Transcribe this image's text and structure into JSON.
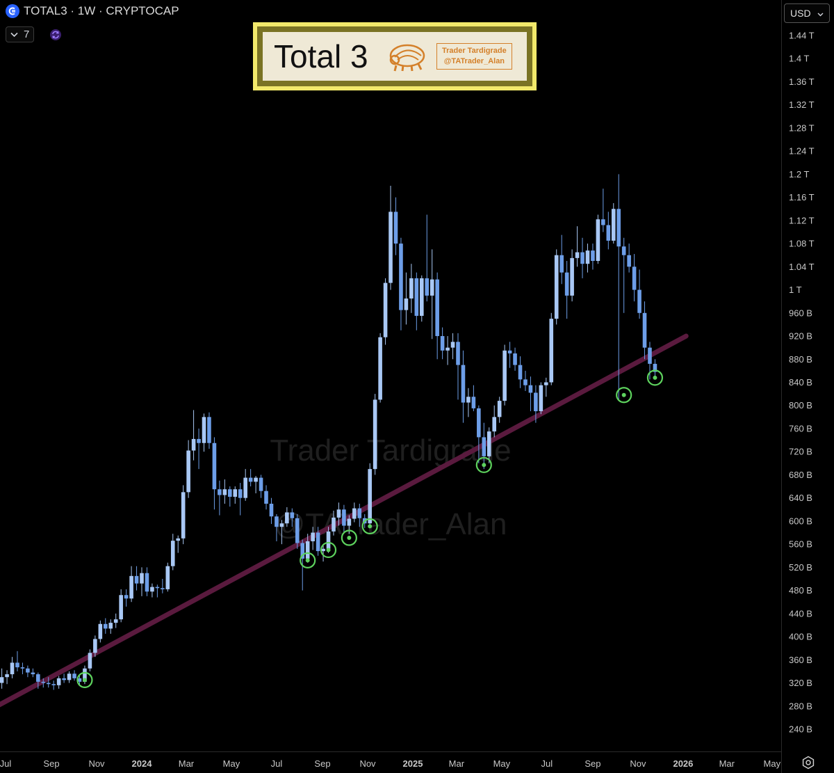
{
  "header": {
    "symbol": "TOTAL3 · 1W · CRYPTOCAP",
    "indicator_count": "7"
  },
  "banner": {
    "title": "Total 3",
    "logo_line1": "Trader Tardigrade",
    "logo_line2": "@TATrader_Alan"
  },
  "currency": "USD",
  "watermark": {
    "line1": "Trader Tardigrade",
    "line2": "@TATrader_Alan"
  },
  "colors": {
    "up": "#a9c8f5",
    "down": "#6d9ee8",
    "trendline": "#5a1a3e",
    "circle": "#5ed35e",
    "grid_text": "#c8c8c8"
  },
  "chart_data": {
    "type": "candlestick",
    "timeframe": "1W",
    "y_tick_labels": [
      "240 B",
      "280 B",
      "320 B",
      "360 B",
      "400 B",
      "440 B",
      "480 B",
      "520 B",
      "560 B",
      "600 B",
      "640 B",
      "680 B",
      "720 B",
      "760 B",
      "800 B",
      "840 B",
      "880 B",
      "920 B",
      "960 B",
      "1 T",
      "1.04 T",
      "1.08 T",
      "1.12 T",
      "1.16 T",
      "1.2 T",
      "1.24 T",
      "1.28 T",
      "1.32 T",
      "1.36 T",
      "1.4 T",
      "1.44 T"
    ],
    "y_tick_values": [
      240,
      280,
      320,
      360,
      400,
      440,
      480,
      520,
      560,
      600,
      640,
      680,
      720,
      760,
      800,
      840,
      880,
      920,
      960,
      1000,
      1040,
      1080,
      1120,
      1160,
      1200,
      1240,
      1280,
      1320,
      1360,
      1400,
      1440
    ],
    "y_unit": "B",
    "x_tick_labels": [
      "Jul",
      "Sep",
      "Nov",
      "2024",
      "Mar",
      "May",
      "Jul",
      "Sep",
      "Nov",
      "2025",
      "Mar",
      "May",
      "Jul",
      "Sep",
      "Nov",
      "2026",
      "Mar",
      "May"
    ],
    "x_tick_dates": [
      "2023-07-01",
      "2023-09-01",
      "2023-11-01",
      "2024-01-01",
      "2024-03-01",
      "2024-05-01",
      "2024-07-01",
      "2024-09-01",
      "2024-11-01",
      "2025-01-01",
      "2025-03-01",
      "2025-05-01",
      "2025-07-01",
      "2025-09-01",
      "2025-11-01",
      "2026-01-01",
      "2026-03-01",
      "2026-05-01"
    ],
    "candles": [
      {
        "d": "2023-06-26",
        "o": 320,
        "h": 345,
        "l": 310,
        "c": 330
      },
      {
        "d": "2023-07-03",
        "o": 330,
        "h": 342,
        "l": 318,
        "c": 335
      },
      {
        "d": "2023-07-10",
        "o": 335,
        "h": 365,
        "l": 328,
        "c": 355
      },
      {
        "d": "2023-07-17",
        "o": 355,
        "h": 375,
        "l": 340,
        "c": 347
      },
      {
        "d": "2023-07-24",
        "o": 347,
        "h": 355,
        "l": 335,
        "c": 345
      },
      {
        "d": "2023-07-31",
        "o": 345,
        "h": 350,
        "l": 330,
        "c": 338
      },
      {
        "d": "2023-08-07",
        "o": 338,
        "h": 345,
        "l": 330,
        "c": 335
      },
      {
        "d": "2023-08-14",
        "o": 335,
        "h": 338,
        "l": 310,
        "c": 322
      },
      {
        "d": "2023-08-21",
        "o": 322,
        "h": 328,
        "l": 312,
        "c": 320
      },
      {
        "d": "2023-08-28",
        "o": 320,
        "h": 330,
        "l": 312,
        "c": 318
      },
      {
        "d": "2023-09-04",
        "o": 318,
        "h": 324,
        "l": 308,
        "c": 316
      },
      {
        "d": "2023-09-11",
        "o": 316,
        "h": 332,
        "l": 310,
        "c": 328
      },
      {
        "d": "2023-09-18",
        "o": 328,
        "h": 336,
        "l": 320,
        "c": 325
      },
      {
        "d": "2023-09-25",
        "o": 325,
        "h": 340,
        "l": 320,
        "c": 336
      },
      {
        "d": "2023-10-02",
        "o": 336,
        "h": 342,
        "l": 324,
        "c": 328
      },
      {
        "d": "2023-10-09",
        "o": 328,
        "h": 332,
        "l": 316,
        "c": 322
      },
      {
        "d": "2023-10-16",
        "o": 322,
        "h": 350,
        "l": 318,
        "c": 345
      },
      {
        "d": "2023-10-23",
        "o": 345,
        "h": 378,
        "l": 340,
        "c": 372
      },
      {
        "d": "2023-10-30",
        "o": 372,
        "h": 402,
        "l": 365,
        "c": 396
      },
      {
        "d": "2023-11-06",
        "o": 396,
        "h": 428,
        "l": 390,
        "c": 422
      },
      {
        "d": "2023-11-13",
        "o": 422,
        "h": 432,
        "l": 405,
        "c": 414
      },
      {
        "d": "2023-11-20",
        "o": 414,
        "h": 430,
        "l": 405,
        "c": 424
      },
      {
        "d": "2023-11-27",
        "o": 424,
        "h": 440,
        "l": 415,
        "c": 430
      },
      {
        "d": "2023-12-04",
        "o": 430,
        "h": 482,
        "l": 425,
        "c": 472
      },
      {
        "d": "2023-12-11",
        "o": 472,
        "h": 482,
        "l": 452,
        "c": 466
      },
      {
        "d": "2023-12-18",
        "o": 466,
        "h": 522,
        "l": 460,
        "c": 505
      },
      {
        "d": "2023-12-25",
        "o": 505,
        "h": 522,
        "l": 480,
        "c": 492
      },
      {
        "d": "2024-01-01",
        "o": 492,
        "h": 520,
        "l": 470,
        "c": 510
      },
      {
        "d": "2024-01-08",
        "o": 510,
        "h": 520,
        "l": 470,
        "c": 478
      },
      {
        "d": "2024-01-15",
        "o": 478,
        "h": 492,
        "l": 468,
        "c": 486
      },
      {
        "d": "2024-01-22",
        "o": 486,
        "h": 490,
        "l": 468,
        "c": 484
      },
      {
        "d": "2024-01-29",
        "o": 484,
        "h": 500,
        "l": 475,
        "c": 482
      },
      {
        "d": "2024-02-05",
        "o": 482,
        "h": 528,
        "l": 478,
        "c": 522
      },
      {
        "d": "2024-02-12",
        "o": 522,
        "h": 578,
        "l": 515,
        "c": 566
      },
      {
        "d": "2024-02-19",
        "o": 566,
        "h": 575,
        "l": 545,
        "c": 570
      },
      {
        "d": "2024-02-26",
        "o": 570,
        "h": 662,
        "l": 560,
        "c": 650
      },
      {
        "d": "2024-03-04",
        "o": 650,
        "h": 740,
        "l": 640,
        "c": 722
      },
      {
        "d": "2024-03-11",
        "o": 722,
        "h": 792,
        "l": 705,
        "c": 742
      },
      {
        "d": "2024-03-18",
        "o": 742,
        "h": 760,
        "l": 690,
        "c": 735
      },
      {
        "d": "2024-03-25",
        "o": 735,
        "h": 786,
        "l": 720,
        "c": 780
      },
      {
        "d": "2024-04-01",
        "o": 780,
        "h": 788,
        "l": 725,
        "c": 735
      },
      {
        "d": "2024-04-08",
        "o": 735,
        "h": 745,
        "l": 620,
        "c": 655
      },
      {
        "d": "2024-04-15",
        "o": 655,
        "h": 670,
        "l": 610,
        "c": 645
      },
      {
        "d": "2024-04-22",
        "o": 645,
        "h": 672,
        "l": 630,
        "c": 655
      },
      {
        "d": "2024-04-29",
        "o": 655,
        "h": 660,
        "l": 625,
        "c": 642
      },
      {
        "d": "2024-05-06",
        "o": 642,
        "h": 660,
        "l": 630,
        "c": 655
      },
      {
        "d": "2024-05-13",
        "o": 655,
        "h": 666,
        "l": 610,
        "c": 640
      },
      {
        "d": "2024-05-20",
        "o": 640,
        "h": 690,
        "l": 635,
        "c": 675
      },
      {
        "d": "2024-05-27",
        "o": 675,
        "h": 690,
        "l": 660,
        "c": 668
      },
      {
        "d": "2024-06-03",
        "o": 668,
        "h": 678,
        "l": 648,
        "c": 675
      },
      {
        "d": "2024-06-10",
        "o": 675,
        "h": 680,
        "l": 640,
        "c": 652
      },
      {
        "d": "2024-06-17",
        "o": 652,
        "h": 662,
        "l": 620,
        "c": 630
      },
      {
        "d": "2024-06-24",
        "o": 630,
        "h": 640,
        "l": 595,
        "c": 608
      },
      {
        "d": "2024-07-01",
        "o": 608,
        "h": 612,
        "l": 565,
        "c": 590
      },
      {
        "d": "2024-07-08",
        "o": 590,
        "h": 602,
        "l": 560,
        "c": 596
      },
      {
        "d": "2024-07-15",
        "o": 596,
        "h": 624,
        "l": 590,
        "c": 615
      },
      {
        "d": "2024-07-22",
        "o": 615,
        "h": 622,
        "l": 590,
        "c": 605
      },
      {
        "d": "2024-07-29",
        "o": 605,
        "h": 612,
        "l": 552,
        "c": 562
      },
      {
        "d": "2024-08-05",
        "o": 562,
        "h": 568,
        "l": 480,
        "c": 535
      },
      {
        "d": "2024-08-12",
        "o": 535,
        "h": 578,
        "l": 528,
        "c": 565
      },
      {
        "d": "2024-08-19",
        "o": 565,
        "h": 590,
        "l": 550,
        "c": 580
      },
      {
        "d": "2024-08-26",
        "o": 580,
        "h": 590,
        "l": 540,
        "c": 548
      },
      {
        "d": "2024-09-02",
        "o": 548,
        "h": 558,
        "l": 530,
        "c": 552
      },
      {
        "d": "2024-09-09",
        "o": 552,
        "h": 590,
        "l": 545,
        "c": 582
      },
      {
        "d": "2024-09-16",
        "o": 582,
        "h": 618,
        "l": 575,
        "c": 606
      },
      {
        "d": "2024-09-23",
        "o": 606,
        "h": 632,
        "l": 592,
        "c": 620
      },
      {
        "d": "2024-09-30",
        "o": 620,
        "h": 628,
        "l": 580,
        "c": 592
      },
      {
        "d": "2024-10-07",
        "o": 592,
        "h": 610,
        "l": 578,
        "c": 604
      },
      {
        "d": "2024-10-14",
        "o": 604,
        "h": 632,
        "l": 598,
        "c": 622
      },
      {
        "d": "2024-10-21",
        "o": 622,
        "h": 630,
        "l": 590,
        "c": 605
      },
      {
        "d": "2024-10-28",
        "o": 605,
        "h": 612,
        "l": 588,
        "c": 596
      },
      {
        "d": "2024-11-04",
        "o": 596,
        "h": 700,
        "l": 590,
        "c": 690
      },
      {
        "d": "2024-11-11",
        "o": 690,
        "h": 820,
        "l": 680,
        "c": 810
      },
      {
        "d": "2024-11-18",
        "o": 810,
        "h": 925,
        "l": 805,
        "c": 918
      },
      {
        "d": "2024-11-25",
        "o": 918,
        "h": 1020,
        "l": 905,
        "c": 1012
      },
      {
        "d": "2024-12-02",
        "o": 1012,
        "h": 1180,
        "l": 1000,
        "c": 1135
      },
      {
        "d": "2024-12-09",
        "o": 1135,
        "h": 1160,
        "l": 1060,
        "c": 1080
      },
      {
        "d": "2024-12-16",
        "o": 1080,
        "h": 1090,
        "l": 930,
        "c": 965
      },
      {
        "d": "2024-12-23",
        "o": 965,
        "h": 1030,
        "l": 940,
        "c": 985
      },
      {
        "d": "2024-12-30",
        "o": 985,
        "h": 1045,
        "l": 960,
        "c": 1020
      },
      {
        "d": "2025-01-06",
        "o": 1020,
        "h": 1030,
        "l": 930,
        "c": 955
      },
      {
        "d": "2025-01-13",
        "o": 955,
        "h": 1025,
        "l": 945,
        "c": 1020
      },
      {
        "d": "2025-01-20",
        "o": 1020,
        "h": 1130,
        "l": 980,
        "c": 990
      },
      {
        "d": "2025-01-27",
        "o": 990,
        "h": 1070,
        "l": 915,
        "c": 1018
      },
      {
        "d": "2025-02-03",
        "o": 1018,
        "h": 1030,
        "l": 880,
        "c": 920
      },
      {
        "d": "2025-02-10",
        "o": 920,
        "h": 935,
        "l": 880,
        "c": 895
      },
      {
        "d": "2025-02-17",
        "o": 895,
        "h": 920,
        "l": 870,
        "c": 900
      },
      {
        "d": "2025-02-24",
        "o": 900,
        "h": 925,
        "l": 880,
        "c": 910
      },
      {
        "d": "2025-03-03",
        "o": 910,
        "h": 925,
        "l": 810,
        "c": 870
      },
      {
        "d": "2025-03-10",
        "o": 870,
        "h": 895,
        "l": 770,
        "c": 805
      },
      {
        "d": "2025-03-17",
        "o": 805,
        "h": 830,
        "l": 780,
        "c": 815
      },
      {
        "d": "2025-03-24",
        "o": 815,
        "h": 835,
        "l": 790,
        "c": 795
      },
      {
        "d": "2025-03-31",
        "o": 795,
        "h": 800,
        "l": 700,
        "c": 745
      },
      {
        "d": "2025-04-07",
        "o": 745,
        "h": 770,
        "l": 690,
        "c": 712
      },
      {
        "d": "2025-04-14",
        "o": 712,
        "h": 762,
        "l": 700,
        "c": 755
      },
      {
        "d": "2025-04-21",
        "o": 755,
        "h": 800,
        "l": 745,
        "c": 780
      },
      {
        "d": "2025-04-28",
        "o": 780,
        "h": 815,
        "l": 770,
        "c": 808
      },
      {
        "d": "2025-05-05",
        "o": 808,
        "h": 905,
        "l": 800,
        "c": 895
      },
      {
        "d": "2025-05-12",
        "o": 895,
        "h": 910,
        "l": 865,
        "c": 890
      },
      {
        "d": "2025-05-19",
        "o": 890,
        "h": 900,
        "l": 860,
        "c": 870
      },
      {
        "d": "2025-05-26",
        "o": 870,
        "h": 885,
        "l": 830,
        "c": 845
      },
      {
        "d": "2025-06-02",
        "o": 845,
        "h": 860,
        "l": 825,
        "c": 835
      },
      {
        "d": "2025-06-09",
        "o": 835,
        "h": 850,
        "l": 790,
        "c": 822
      },
      {
        "d": "2025-06-16",
        "o": 822,
        "h": 835,
        "l": 770,
        "c": 790
      },
      {
        "d": "2025-06-23",
        "o": 790,
        "h": 840,
        "l": 785,
        "c": 835
      },
      {
        "d": "2025-06-30",
        "o": 835,
        "h": 848,
        "l": 815,
        "c": 840
      },
      {
        "d": "2025-07-07",
        "o": 840,
        "h": 960,
        "l": 835,
        "c": 950
      },
      {
        "d": "2025-07-14",
        "o": 950,
        "h": 1070,
        "l": 940,
        "c": 1060
      },
      {
        "d": "2025-07-21",
        "o": 1060,
        "h": 1095,
        "l": 1010,
        "c": 1030
      },
      {
        "d": "2025-07-28",
        "o": 1030,
        "h": 1050,
        "l": 950,
        "c": 990
      },
      {
        "d": "2025-08-04",
        "o": 990,
        "h": 1070,
        "l": 980,
        "c": 1055
      },
      {
        "d": "2025-08-11",
        "o": 1055,
        "h": 1110,
        "l": 1040,
        "c": 1065
      },
      {
        "d": "2025-08-18",
        "o": 1065,
        "h": 1090,
        "l": 1020,
        "c": 1045
      },
      {
        "d": "2025-08-25",
        "o": 1045,
        "h": 1080,
        "l": 1030,
        "c": 1068
      },
      {
        "d": "2025-09-01",
        "o": 1068,
        "h": 1080,
        "l": 1035,
        "c": 1050
      },
      {
        "d": "2025-09-08",
        "o": 1050,
        "h": 1130,
        "l": 1045,
        "c": 1122
      },
      {
        "d": "2025-09-15",
        "o": 1122,
        "h": 1175,
        "l": 1100,
        "c": 1112
      },
      {
        "d": "2025-09-22",
        "o": 1112,
        "h": 1135,
        "l": 1070,
        "c": 1085
      },
      {
        "d": "2025-09-29",
        "o": 1085,
        "h": 1150,
        "l": 1080,
        "c": 1140
      },
      {
        "d": "2025-10-06",
        "o": 1140,
        "h": 1200,
        "l": 810,
        "c": 1075
      },
      {
        "d": "2025-10-13",
        "o": 1075,
        "h": 1090,
        "l": 960,
        "c": 1060
      },
      {
        "d": "2025-10-20",
        "o": 1060,
        "h": 1080,
        "l": 1030,
        "c": 1040
      },
      {
        "d": "2025-10-27",
        "o": 1040,
        "h": 1062,
        "l": 980,
        "c": 1000
      },
      {
        "d": "2025-11-03",
        "o": 1000,
        "h": 1035,
        "l": 950,
        "c": 960
      },
      {
        "d": "2025-11-10",
        "o": 960,
        "h": 980,
        "l": 880,
        "c": 900
      },
      {
        "d": "2025-11-17",
        "o": 900,
        "h": 910,
        "l": 845,
        "c": 872
      },
      {
        "d": "2025-11-24",
        "o": 872,
        "h": 880,
        "l": 850,
        "c": 858
      }
    ],
    "support_line": {
      "start": {
        "d": "2023-06-05",
        "v": 270
      },
      "end": {
        "d": "2026-01-05",
        "v": 920
      }
    },
    "touch_points": [
      {
        "d": "2023-10-16",
        "v": 325
      },
      {
        "d": "2024-08-12",
        "v": 532
      },
      {
        "d": "2024-09-09",
        "v": 550
      },
      {
        "d": "2024-10-07",
        "v": 571
      },
      {
        "d": "2024-11-04",
        "v": 591
      },
      {
        "d": "2025-04-07",
        "v": 697
      },
      {
        "d": "2025-10-13",
        "v": 818
      },
      {
        "d": "2025-11-24",
        "v": 848
      }
    ]
  }
}
